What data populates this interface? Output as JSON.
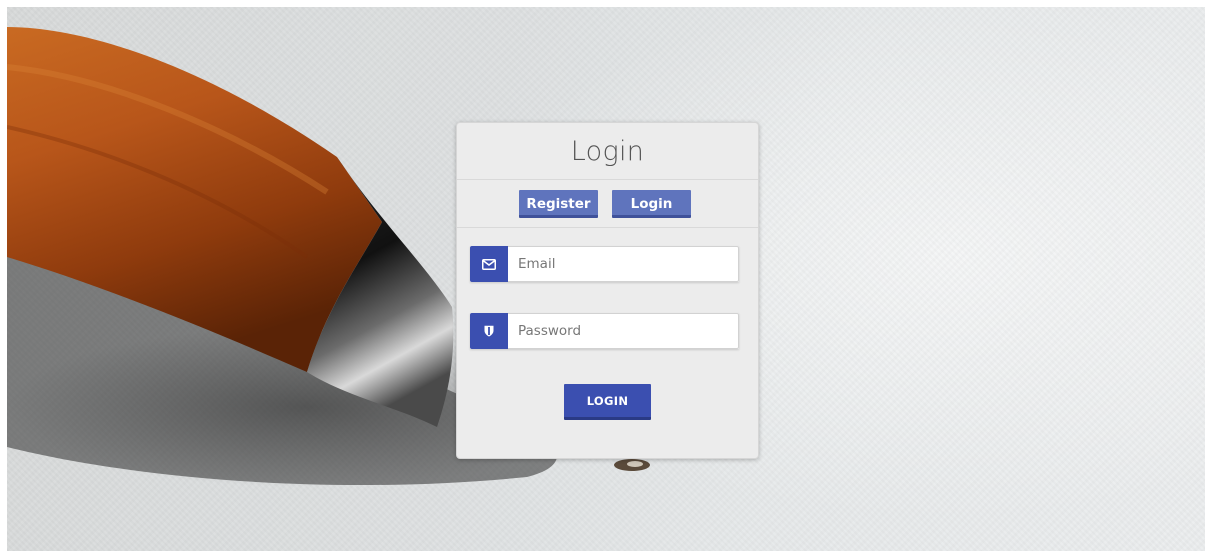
{
  "panel": {
    "title": "Login"
  },
  "tabs": {
    "register_label": "Register",
    "login_label": "Login"
  },
  "form": {
    "email": {
      "placeholder": "Email",
      "value": "",
      "icon": "envelope-icon"
    },
    "password": {
      "placeholder": "Password",
      "value": "",
      "icon": "shield-icon"
    },
    "submit_label": "LOGIN"
  },
  "colors": {
    "tab_button": "#5f74bd",
    "primary": "#3b4fb0",
    "panel_bg": "#ececec"
  }
}
